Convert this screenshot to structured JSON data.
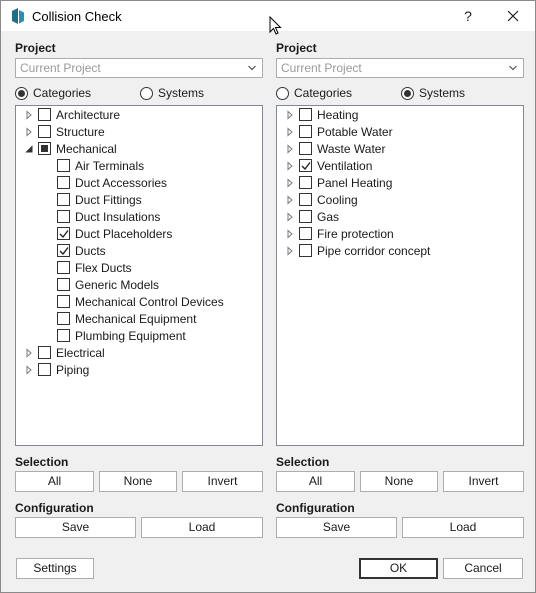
{
  "window": {
    "title": "Collision Check",
    "help_label": "?",
    "close_label": "✕"
  },
  "left": {
    "project_label": "Project",
    "project_placeholder": "Current Project",
    "radio_categories": "Categories",
    "radio_systems": "Systems",
    "selected_radio": "categories",
    "tree": [
      {
        "label": "Architecture",
        "level": 0,
        "expander": "collapsed",
        "state": "unchecked"
      },
      {
        "label": "Structure",
        "level": 0,
        "expander": "collapsed",
        "state": "unchecked"
      },
      {
        "label": "Mechanical",
        "level": 0,
        "expander": "expanded",
        "state": "partial"
      },
      {
        "label": "Air Terminals",
        "level": 1,
        "expander": "none",
        "state": "unchecked"
      },
      {
        "label": "Duct Accessories",
        "level": 1,
        "expander": "none",
        "state": "unchecked"
      },
      {
        "label": "Duct Fittings",
        "level": 1,
        "expander": "none",
        "state": "unchecked"
      },
      {
        "label": "Duct Insulations",
        "level": 1,
        "expander": "none",
        "state": "unchecked"
      },
      {
        "label": "Duct Placeholders",
        "level": 1,
        "expander": "none",
        "state": "checked"
      },
      {
        "label": "Ducts",
        "level": 1,
        "expander": "none",
        "state": "checked"
      },
      {
        "label": "Flex Ducts",
        "level": 1,
        "expander": "none",
        "state": "unchecked"
      },
      {
        "label": "Generic Models",
        "level": 1,
        "expander": "none",
        "state": "unchecked"
      },
      {
        "label": "Mechanical Control Devices",
        "level": 1,
        "expander": "none",
        "state": "unchecked"
      },
      {
        "label": "Mechanical Equipment",
        "level": 1,
        "expander": "none",
        "state": "unchecked"
      },
      {
        "label": "Plumbing Equipment",
        "level": 1,
        "expander": "none",
        "state": "unchecked"
      },
      {
        "label": "Electrical",
        "level": 0,
        "expander": "collapsed",
        "state": "unchecked"
      },
      {
        "label": "Piping",
        "level": 0,
        "expander": "collapsed",
        "state": "unchecked"
      }
    ],
    "selection_label": "Selection",
    "btn_all": "All",
    "btn_none": "None",
    "btn_invert": "Invert",
    "configuration_label": "Configuration",
    "btn_save": "Save",
    "btn_load": "Load"
  },
  "right": {
    "project_label": "Project",
    "project_placeholder": "Current Project",
    "radio_categories": "Categories",
    "radio_systems": "Systems",
    "selected_radio": "systems",
    "tree": [
      {
        "label": "Heating",
        "level": 0,
        "expander": "collapsed",
        "state": "unchecked"
      },
      {
        "label": "Potable Water",
        "level": 0,
        "expander": "collapsed",
        "state": "unchecked"
      },
      {
        "label": "Waste Water",
        "level": 0,
        "expander": "collapsed",
        "state": "unchecked"
      },
      {
        "label": "Ventilation",
        "level": 0,
        "expander": "collapsed",
        "state": "checked"
      },
      {
        "label": "Panel Heating",
        "level": 0,
        "expander": "collapsed",
        "state": "unchecked"
      },
      {
        "label": "Cooling",
        "level": 0,
        "expander": "collapsed",
        "state": "unchecked"
      },
      {
        "label": "Gas",
        "level": 0,
        "expander": "collapsed",
        "state": "unchecked"
      },
      {
        "label": "Fire protection",
        "level": 0,
        "expander": "collapsed",
        "state": "unchecked"
      },
      {
        "label": "Pipe corridor concept",
        "level": 0,
        "expander": "collapsed",
        "state": "unchecked"
      }
    ],
    "selection_label": "Selection",
    "btn_all": "All",
    "btn_none": "None",
    "btn_invert": "Invert",
    "configuration_label": "Configuration",
    "btn_save": "Save",
    "btn_load": "Load"
  },
  "footer": {
    "settings_label": "Settings",
    "ok_label": "OK",
    "cancel_label": "Cancel"
  },
  "icons": {
    "app": "app-logo-icon",
    "dropdown": "chevron-down-icon",
    "expander_collapsed": "triangle-right-icon",
    "expander_expanded": "triangle-down-icon",
    "check": "checkmark-icon"
  },
  "colors": {
    "window_bg": "#f0f0f0",
    "border": "#adadad",
    "app_icon": "#1f6f8b"
  }
}
